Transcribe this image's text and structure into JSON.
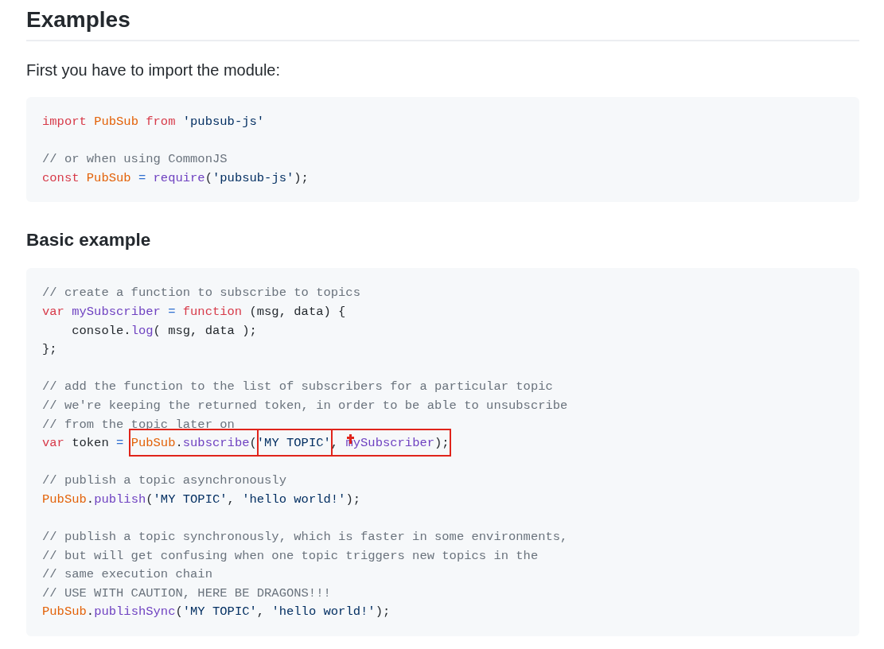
{
  "blocks": [
    {
      "kind": "heading",
      "text": "Examples"
    },
    {
      "kind": "paragraph",
      "text": "First you have to import the module:"
    },
    {
      "kind": "code",
      "lines": [
        {
          "kind": "text",
          "tokens": [
            {
              "kind": "keyword",
              "text": "import "
            },
            {
              "kind": "name",
              "text": "PubSub "
            },
            {
              "kind": "keyword",
              "text": "from "
            },
            {
              "kind": "string",
              "text": "'pubsub-js'"
            }
          ]
        },
        {
          "kind": "blank"
        },
        {
          "kind": "text",
          "tokens": [
            {
              "kind": "comment",
              "text": "// or when using CommonJS"
            }
          ]
        },
        {
          "kind": "text",
          "tokens": [
            {
              "kind": "keyword",
              "text": "const "
            },
            {
              "kind": "name",
              "text": "PubSub "
            },
            {
              "kind": "operator",
              "text": "= "
            },
            {
              "kind": "function",
              "text": "require"
            },
            {
              "kind": "plain",
              "text": "("
            },
            {
              "kind": "string",
              "text": "'pubsub-js'"
            },
            {
              "kind": "plain",
              "text": ");"
            }
          ]
        }
      ]
    },
    {
      "kind": "subheading",
      "text": "Basic example"
    },
    {
      "kind": "code",
      "lines": [
        {
          "kind": "text",
          "tokens": [
            {
              "kind": "comment",
              "text": "// create a function to subscribe to topics"
            }
          ]
        },
        {
          "kind": "text",
          "tokens": [
            {
              "kind": "keyword",
              "text": "var "
            },
            {
              "kind": "function",
              "text": "mySubscriber "
            },
            {
              "kind": "operator",
              "text": "= "
            },
            {
              "kind": "keyword",
              "text": "function "
            },
            {
              "kind": "plain",
              "text": "(msg, data) {"
            }
          ]
        },
        {
          "kind": "text",
          "tokens": [
            {
              "kind": "plain",
              "text": "    console."
            },
            {
              "kind": "function",
              "text": "log"
            },
            {
              "kind": "plain",
              "text": "( msg, data );"
            }
          ]
        },
        {
          "kind": "text",
          "tokens": [
            {
              "kind": "plain",
              "text": "};"
            }
          ]
        },
        {
          "kind": "blank"
        },
        {
          "kind": "text",
          "tokens": [
            {
              "kind": "comment",
              "text": "// add the function to the list of subscribers for a particular topic"
            }
          ]
        },
        {
          "kind": "text",
          "tokens": [
            {
              "kind": "comment",
              "text": "// we're keeping the returned token, in order to be able to unsubscribe"
            }
          ]
        },
        {
          "kind": "text",
          "tokens": [
            {
              "kind": "comment",
              "text": "// from the topic later on"
            }
          ]
        },
        {
          "kind": "text",
          "tokens": [
            {
              "kind": "keyword",
              "text": "var "
            },
            {
              "kind": "plain",
              "text": "token "
            },
            {
              "kind": "operator",
              "text": "= "
            },
            {
              "kind": "highlight",
              "tokens": [
                {
                  "kind": "name",
                  "text": "PubSub"
                },
                {
                  "kind": "plain",
                  "text": "."
                },
                {
                  "kind": "function",
                  "text": "subscribe"
                },
                {
                  "kind": "plain",
                  "text": "("
                }
              ]
            },
            {
              "kind": "highlight",
              "tokens": [
                {
                  "kind": "string",
                  "text": "'MY TOPIC'"
                }
              ]
            },
            {
              "kind": "highlight",
              "tokens": [
                {
                  "kind": "plain",
                  "text": ", "
                },
                {
                  "kind": "pointer"
                },
                {
                  "kind": "function",
                  "text": "mySubscriber"
                },
                {
                  "kind": "plain",
                  "text": ");"
                }
              ]
            }
          ]
        },
        {
          "kind": "blank"
        },
        {
          "kind": "text",
          "tokens": [
            {
              "kind": "comment",
              "text": "// publish a topic asynchronously"
            }
          ]
        },
        {
          "kind": "text",
          "tokens": [
            {
              "kind": "name",
              "text": "PubSub"
            },
            {
              "kind": "plain",
              "text": "."
            },
            {
              "kind": "function",
              "text": "publish"
            },
            {
              "kind": "plain",
              "text": "("
            },
            {
              "kind": "string",
              "text": "'MY TOPIC'"
            },
            {
              "kind": "plain",
              "text": ", "
            },
            {
              "kind": "string",
              "text": "'hello world!'"
            },
            {
              "kind": "plain",
              "text": ");"
            }
          ]
        },
        {
          "kind": "blank"
        },
        {
          "kind": "text",
          "tokens": [
            {
              "kind": "comment",
              "text": "// publish a topic synchronously, which is faster in some environments,"
            }
          ]
        },
        {
          "kind": "text",
          "tokens": [
            {
              "kind": "comment",
              "text": "// but will get confusing when one topic triggers new topics in the"
            }
          ]
        },
        {
          "kind": "text",
          "tokens": [
            {
              "kind": "comment",
              "text": "// same execution chain"
            }
          ]
        },
        {
          "kind": "text",
          "tokens": [
            {
              "kind": "comment",
              "text": "// USE WITH CAUTION, HERE BE DRAGONS!!!"
            }
          ]
        },
        {
          "kind": "text",
          "tokens": [
            {
              "kind": "name",
              "text": "PubSub"
            },
            {
              "kind": "plain",
              "text": "."
            },
            {
              "kind": "function",
              "text": "publishSync"
            },
            {
              "kind": "plain",
              "text": "("
            },
            {
              "kind": "string",
              "text": "'MY TOPIC'"
            },
            {
              "kind": "plain",
              "text": ", "
            },
            {
              "kind": "string",
              "text": "'hello world!'"
            },
            {
              "kind": "plain",
              "text": ");"
            }
          ]
        }
      ]
    }
  ]
}
